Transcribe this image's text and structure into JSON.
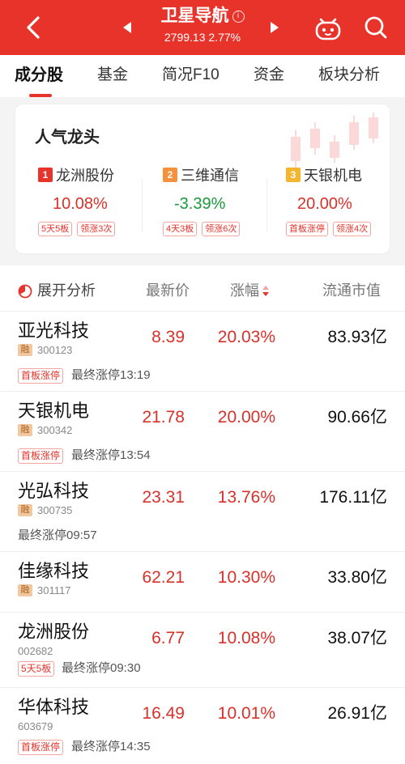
{
  "header": {
    "title": "卫星导航",
    "info_icon": "i",
    "subtitle": "2799.13  2.77%",
    "bg_color": "#e8332b"
  },
  "tabs": [
    {
      "label": "成分股",
      "active": true
    },
    {
      "label": "基金"
    },
    {
      "label": "简况F10"
    },
    {
      "label": "资金"
    },
    {
      "label": "板块分析"
    }
  ],
  "leaders": {
    "title": "人气龙头",
    "items": [
      {
        "rank": "1",
        "name": "龙洲股份",
        "pct": "10.08%",
        "tags": [
          "5天5板",
          "领涨3次"
        ]
      },
      {
        "rank": "2",
        "name": "三维通信",
        "pct": "-3.39%",
        "tags": [
          "4天3板",
          "领涨6次"
        ]
      },
      {
        "rank": "3",
        "name": "天银机电",
        "pct": "20.00%",
        "tags": [
          "首板涨停",
          "领涨4次"
        ]
      }
    ]
  },
  "table": {
    "headers": {
      "expand": "展开分析",
      "price": "最新价",
      "change": "涨幅",
      "mcap": "流通市值"
    },
    "rows": [
      {
        "name": "亚光科技",
        "rong": "融",
        "code": "300123",
        "price": "8.39",
        "change": "20.03%",
        "mcap": "83.93亿",
        "tag": "首板涨停",
        "time": "最终涨停13:19"
      },
      {
        "name": "天银机电",
        "rong": "融",
        "code": "300342",
        "price": "21.78",
        "change": "20.00%",
        "mcap": "90.66亿",
        "tag": "首板涨停",
        "time": "最终涨停13:54"
      },
      {
        "name": "光弘科技",
        "rong": "融",
        "code": "300735",
        "price": "23.31",
        "change": "13.76%",
        "mcap": "176.11亿",
        "tag": "",
        "time": "最终涨停09:57"
      },
      {
        "name": "佳缘科技",
        "rong": "融",
        "code": "301117",
        "price": "62.21",
        "change": "10.30%",
        "mcap": "33.80亿",
        "tag": "",
        "time": ""
      },
      {
        "name": "龙洲股份",
        "rong": "",
        "code": "002682",
        "price": "6.77",
        "change": "10.08%",
        "mcap": "38.07亿",
        "tag": "5天5板",
        "time": "最终涨停09:30"
      },
      {
        "name": "华体科技",
        "rong": "",
        "code": "603679",
        "price": "16.49",
        "change": "10.01%",
        "mcap": "26.91亿",
        "tag": "首板涨停",
        "time": "最终涨停14:35"
      }
    ]
  }
}
